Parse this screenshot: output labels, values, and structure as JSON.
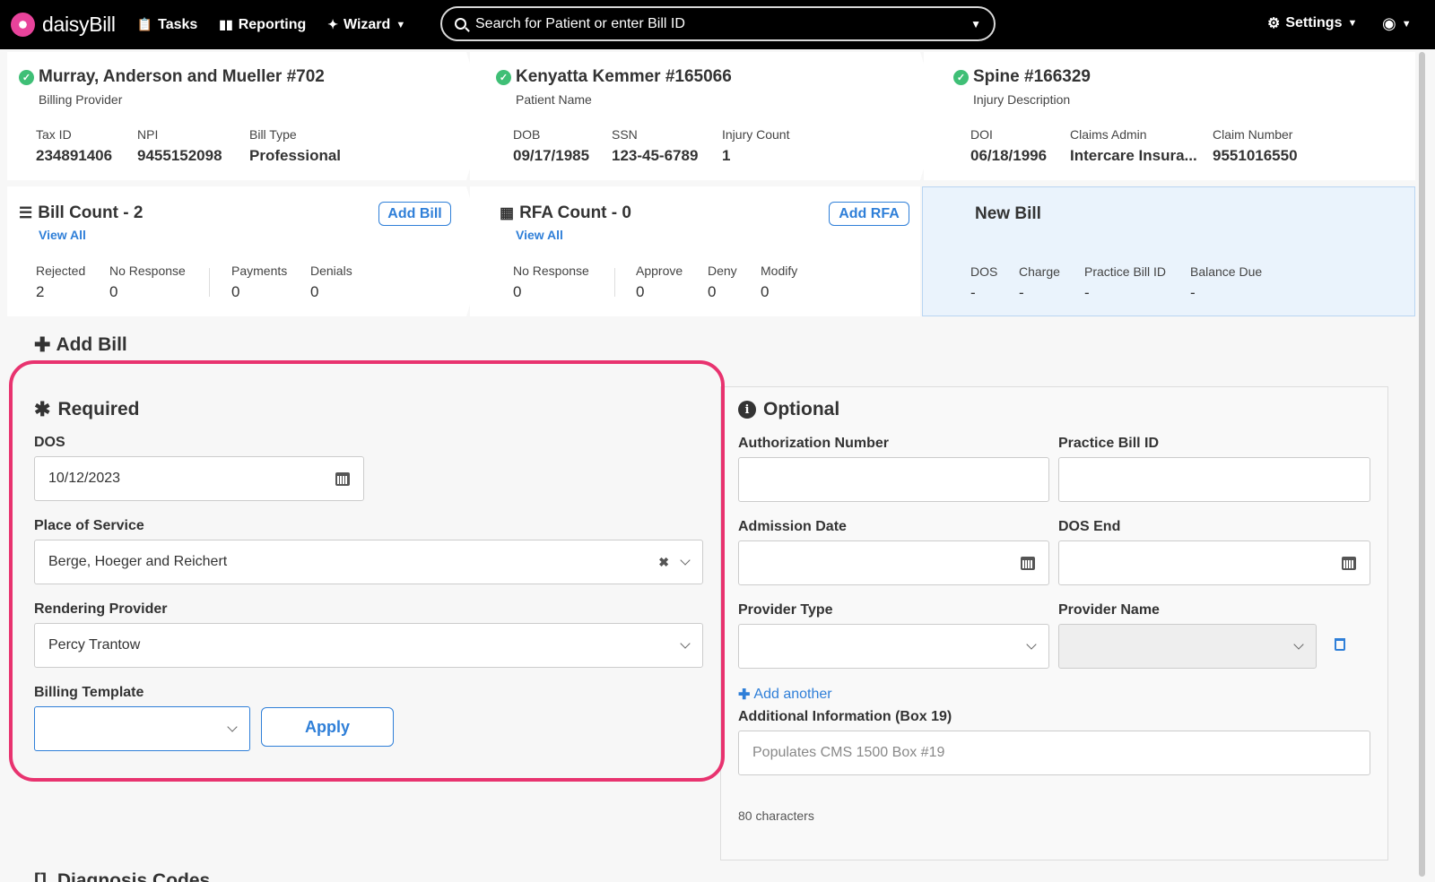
{
  "nav": {
    "logo_text": "daisyBill",
    "tasks": "Tasks",
    "reporting": "Reporting",
    "wizard": "Wizard",
    "search_placeholder": "Search for Patient or enter Bill ID",
    "settings": "Settings"
  },
  "provider_card": {
    "title": "Murray, Anderson and Mueller #702",
    "subtitle": "Billing Provider",
    "fields": [
      {
        "label": "Tax ID",
        "value": "234891406"
      },
      {
        "label": "NPI",
        "value": "9455152098"
      },
      {
        "label": "Bill Type",
        "value": "Professional"
      }
    ]
  },
  "patient_card": {
    "title": "Kenyatta Kemmer #165066",
    "subtitle": "Patient Name",
    "fields": [
      {
        "label": "DOB",
        "value": "09/17/1985"
      },
      {
        "label": "SSN",
        "value": "123-45-6789"
      },
      {
        "label": "Injury Count",
        "value": "1"
      }
    ]
  },
  "injury_card": {
    "title": "Spine #166329",
    "subtitle": "Injury Description",
    "fields": [
      {
        "label": "DOI",
        "value": "06/18/1996"
      },
      {
        "label": "Claims Admin",
        "value": "Intercare Insura..."
      },
      {
        "label": "Claim Number",
        "value": "9551016550"
      }
    ]
  },
  "bill_count_card": {
    "title": "Bill Count - 2",
    "view_all": "View All",
    "add_button": "Add Bill",
    "fields": [
      {
        "label": "Rejected",
        "value": "2"
      },
      {
        "label": "No Response",
        "value": "0"
      },
      {
        "label": "Payments",
        "value": "0"
      },
      {
        "label": "Denials",
        "value": "0"
      }
    ]
  },
  "rfa_card": {
    "title": "RFA Count - 0",
    "view_all": "View All",
    "add_button": "Add RFA",
    "fields": [
      {
        "label": "No Response",
        "value": "0"
      },
      {
        "label": "Approve",
        "value": "0"
      },
      {
        "label": "Deny",
        "value": "0"
      },
      {
        "label": "Modify",
        "value": "0"
      }
    ]
  },
  "new_bill_card": {
    "title": "New Bill",
    "fields": [
      {
        "label": "DOS",
        "value": "-"
      },
      {
        "label": "Charge",
        "value": "-"
      },
      {
        "label": "Practice Bill ID",
        "value": "-"
      },
      {
        "label": "Balance Due",
        "value": "-"
      }
    ]
  },
  "add_bill": {
    "heading": "Add Bill",
    "required": {
      "title": "Required",
      "dos_label": "DOS",
      "dos_value": "10/12/2023",
      "pos_label": "Place of Service",
      "pos_value": "Berge, Hoeger and Reichert",
      "rendering_label": "Rendering Provider",
      "rendering_value": "Percy Trantow",
      "template_label": "Billing Template",
      "template_value": "",
      "apply": "Apply"
    },
    "optional": {
      "title": "Optional",
      "auth_label": "Authorization Number",
      "auth_value": "",
      "practice_id_label": "Practice Bill ID",
      "practice_id_value": "",
      "admission_label": "Admission Date",
      "admission_value": "",
      "dos_end_label": "DOS End",
      "dos_end_value": "",
      "provider_type_label": "Provider Type",
      "provider_type_value": "",
      "provider_name_label": "Provider Name",
      "provider_name_value": "",
      "add_another": "Add another",
      "additional_label": "Additional Information (Box 19)",
      "additional_placeholder": "Populates CMS 1500 Box #19",
      "char_count": "80 characters"
    }
  },
  "diagnosis_heading": "Diagnosis Codes",
  "colors": {
    "accent": "#2f7fd8",
    "highlight": "#e8336f",
    "success": "#3fbf76",
    "new_bill_bg": "#eaf3fc"
  }
}
